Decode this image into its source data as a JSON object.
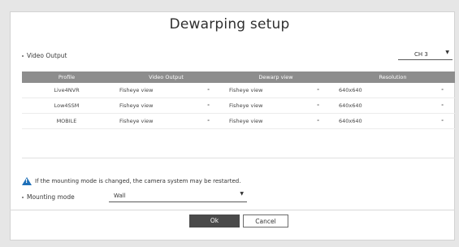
{
  "dialog": {
    "title": "Dewarping setup"
  },
  "video_output_section": {
    "label": "Video Output",
    "channel_value": "CH 3"
  },
  "table": {
    "headers": [
      "Profile",
      "Video Output",
      "Dewarp view",
      "Resolution"
    ],
    "rows": [
      {
        "profile": "Live4NVR",
        "video_output": "Fisheye view",
        "dewarp_view": "Fisheye view",
        "resolution": "640x640"
      },
      {
        "profile": "Low4SSM",
        "video_output": "Fisheye view",
        "dewarp_view": "Fisheye view",
        "resolution": "640x640"
      },
      {
        "profile": "MOBILE",
        "video_output": "Fisheye view",
        "dewarp_view": "Fisheye view",
        "resolution": "640x640"
      }
    ],
    "dash": "-"
  },
  "notice": {
    "text": "If the mounting mode is changed, the camera system may be restarted."
  },
  "mounting_mode": {
    "label": "Mounting mode",
    "value": "Wall"
  },
  "buttons": {
    "ok_label": "Ok",
    "cancel_label": "Cancel"
  },
  "icons": {
    "warning": "warning-icon",
    "dropdown": "chevron-down-icon"
  },
  "colors": {
    "header_bg": "#8d8d8d",
    "warning_icon": "#1e6fb8",
    "ok_button_bg": "#4a4a4a"
  }
}
